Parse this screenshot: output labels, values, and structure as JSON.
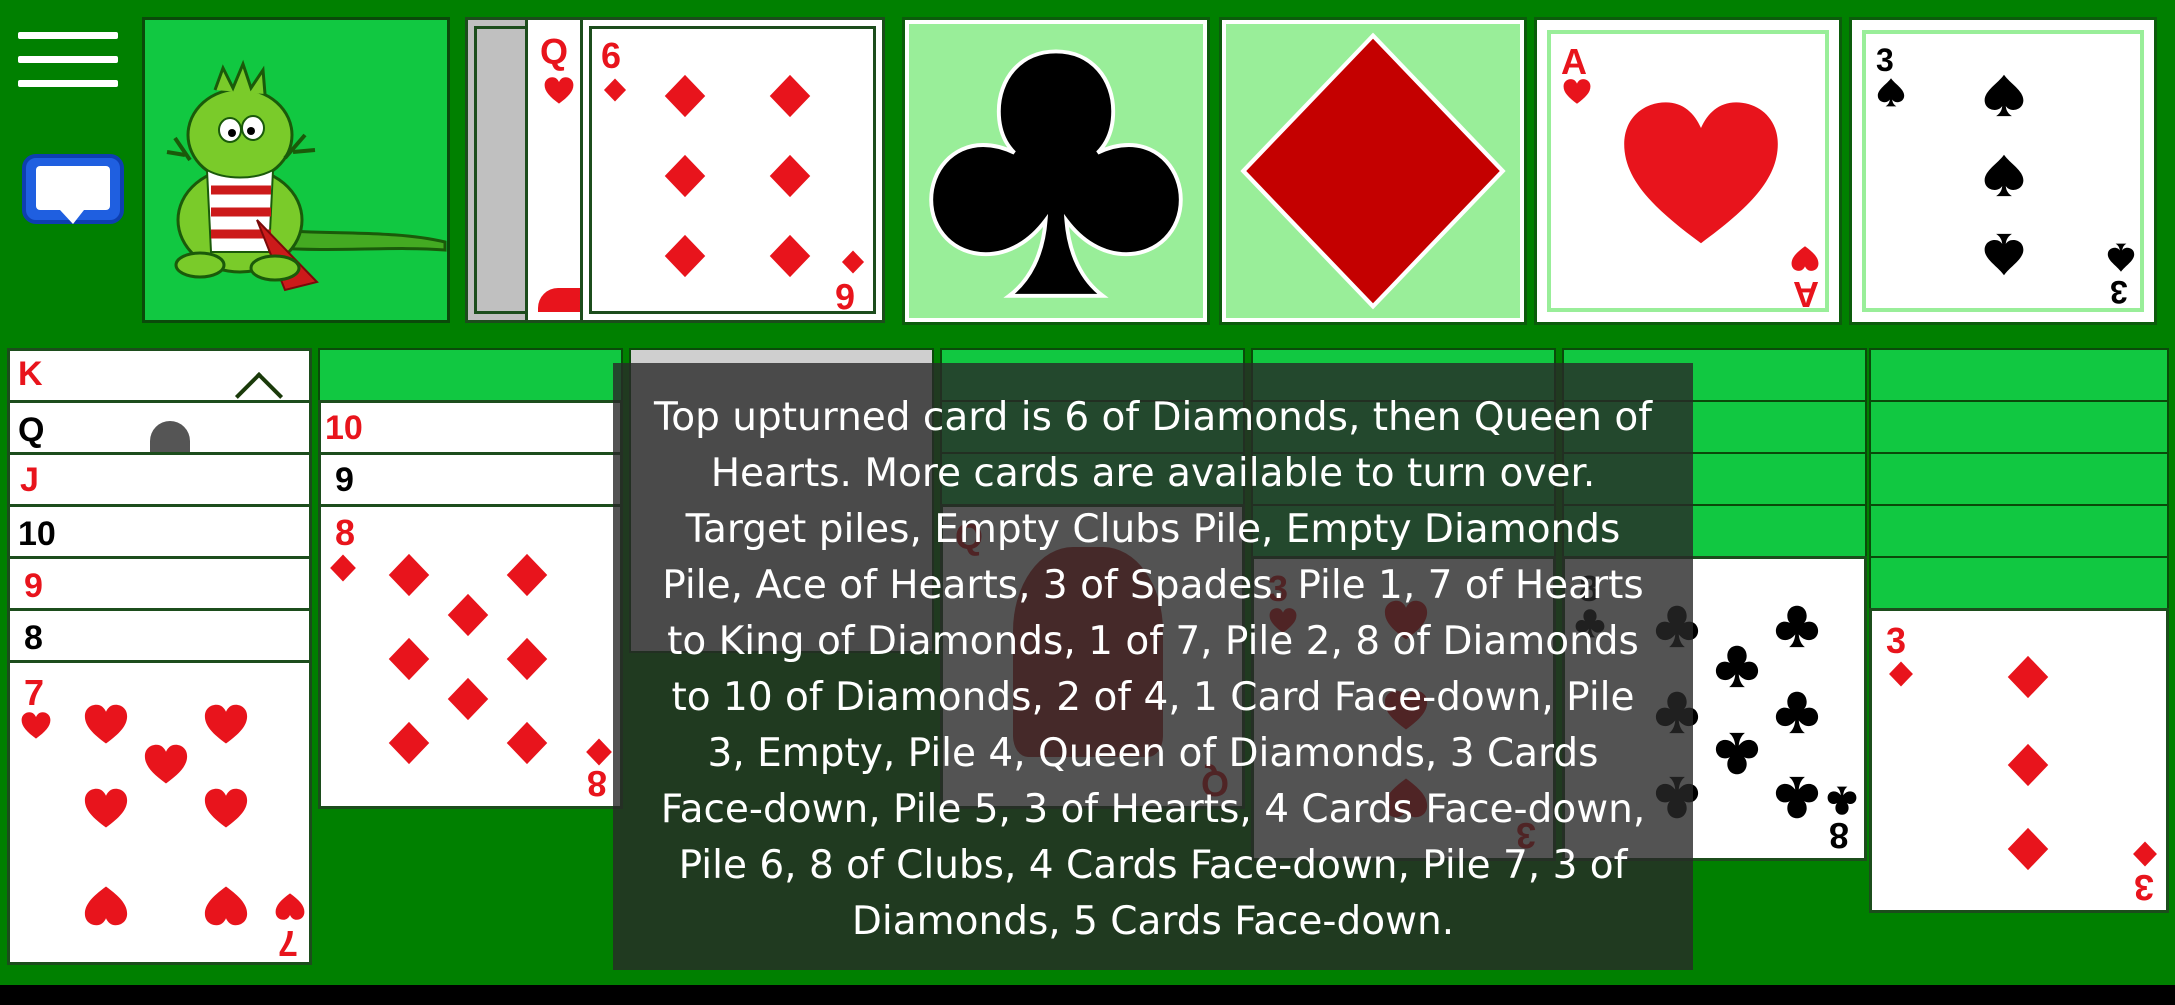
{
  "toolbar": {
    "menu_icon": "hamburger-menu-icon",
    "chat_icon": "speech-bubble-icon"
  },
  "colors": {
    "table_green": "#008000",
    "slot_green": "#11c841",
    "foundation_empty": "#99ee99",
    "red_suit": "#e8141c",
    "black_suit": "#000000"
  },
  "stock": {
    "image": "dragon-mascot-image"
  },
  "waste": {
    "cards": [
      {
        "rank": "Q",
        "suit": "hearts"
      },
      {
        "rank": "6",
        "suit": "diamonds"
      }
    ]
  },
  "foundations": [
    {
      "state": "empty",
      "suit": "clubs"
    },
    {
      "state": "empty",
      "suit": "diamonds"
    },
    {
      "rank": "A",
      "suit": "hearts"
    },
    {
      "rank": "3",
      "suit": "spades"
    }
  ],
  "tableau": {
    "pile1": {
      "ranks": [
        "K",
        "Q",
        "J",
        "10",
        "9",
        "8",
        "7"
      ],
      "top": "7"
    },
    "pile2": {
      "ranks": [
        "10",
        "9",
        "8"
      ],
      "top": "8"
    },
    "pile4": {
      "top": "Q"
    },
    "pile5": {
      "top": "3"
    },
    "pile6": {
      "top": "8"
    },
    "pile7": {
      "top": "3"
    }
  },
  "accessibility_tooltip": "Top upturned card is 6 of Diamonds, then Queen of Hearts.  More cards are available to turn over. Target piles, Empty Clubs Pile, Empty Diamonds Pile, Ace of Hearts, 3 of Spades. Pile 1, 7 of Hearts to King of Diamonds, 1 of 7, Pile 2, 8 of Diamonds to 10 of Diamonds, 2 of 4, 1 Card Face-down, Pile 3, Empty, Pile 4, Queen of Diamonds, 3 Cards Face-down, Pile 5, 3 of Hearts, 4 Cards Face-down, Pile 6, 8 of Clubs, 4 Cards Face-down, Pile 7, 3 of Diamonds, 5 Cards Face-down."
}
